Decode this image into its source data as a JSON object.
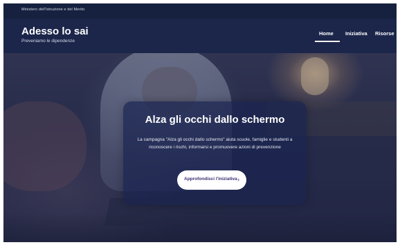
{
  "ministry": "Ministero dell'Istruzione e del Merito",
  "header": {
    "title": "Adesso lo sai",
    "tagline": "Preveniamo le dipendenze"
  },
  "nav": {
    "items": [
      {
        "label": "Home",
        "active": true
      },
      {
        "label": "Iniziativa",
        "active": false
      },
      {
        "label": "Risorse",
        "active": false
      }
    ]
  },
  "hero": {
    "title": "Alza gli occhi dallo schermo",
    "text": "La campagna \"Alza gli occhi dallo schermo\" aiuta scuole, famiglie e studenti a riconoscere i rischi, informarsi e promuovere azioni di prevenzione",
    "cta_label": "Approfondisci l'iniziativa",
    "cta_icon": "chevron-right-icon"
  },
  "colors": {
    "header_bg": "#1c264b",
    "card_bg": "#1a2450",
    "cta_text": "#3b2d72"
  }
}
